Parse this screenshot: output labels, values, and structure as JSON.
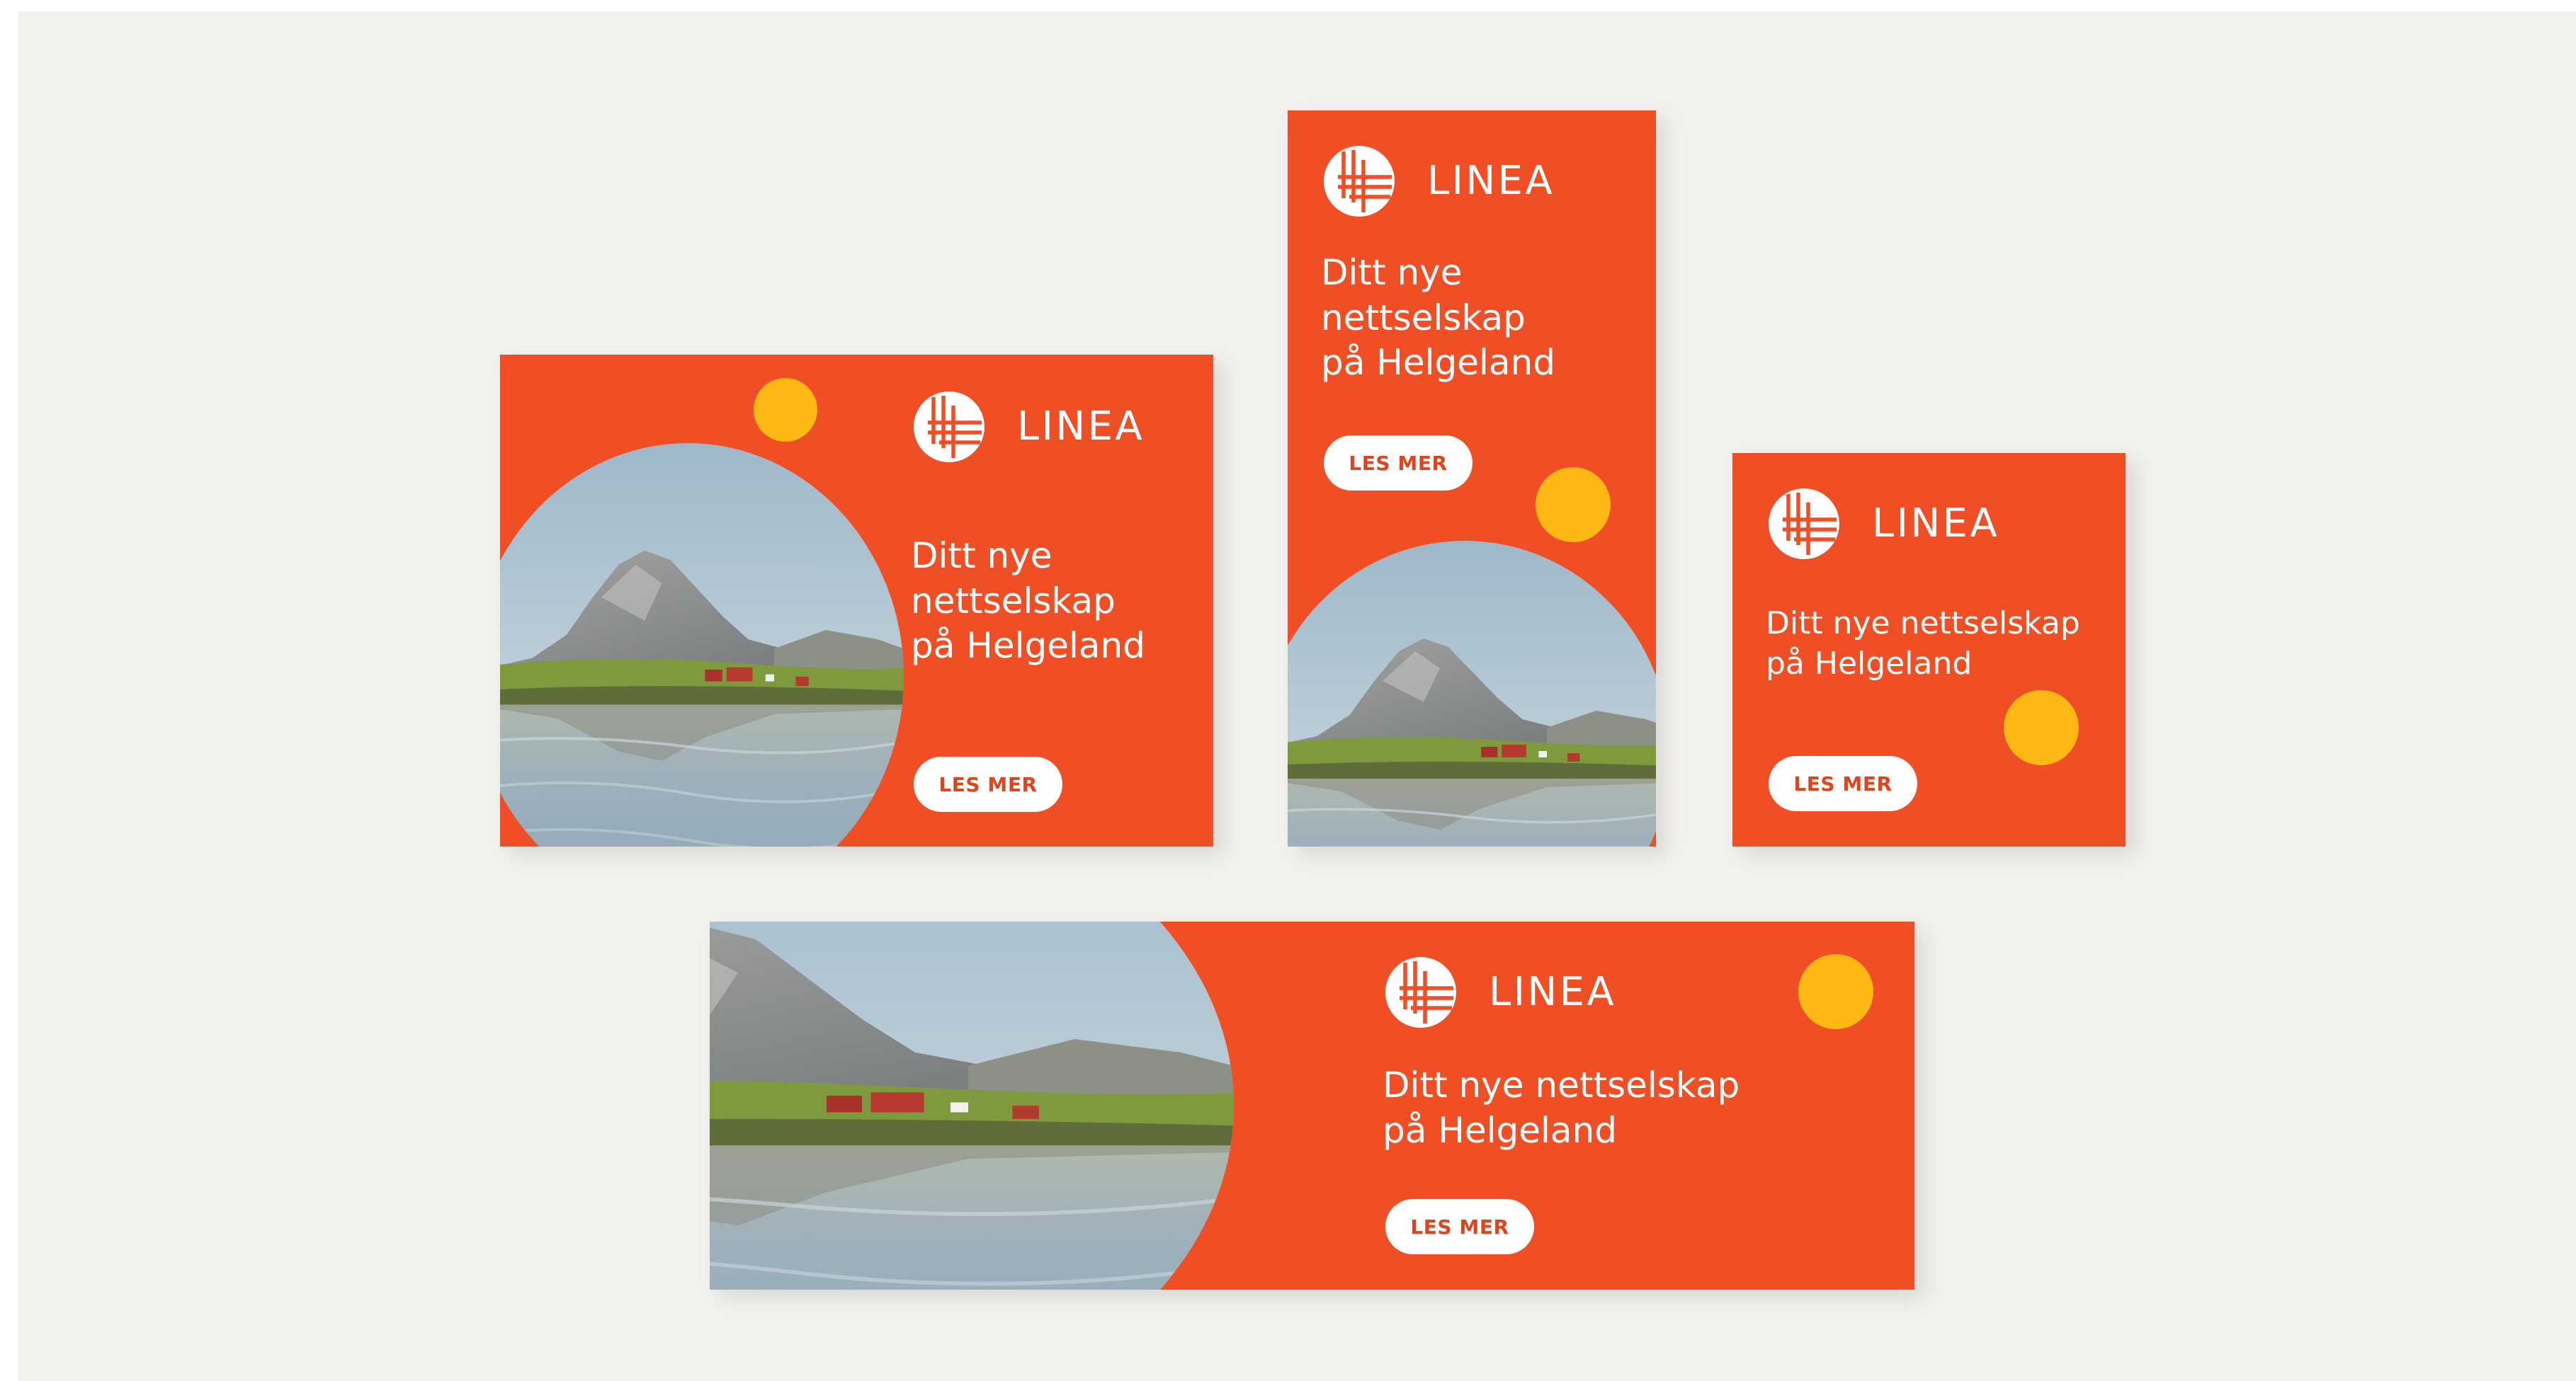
{
  "colors": {
    "background": "#f3f1ed",
    "brand_orange": "#f04f26",
    "accent_yellow": "#fdb813",
    "button_text": "#e0441c",
    "text": "#ffffff"
  },
  "icons": [
    "linea-logo-icon",
    "photo-coastal-landscape"
  ],
  "banners": {
    "medium_rectangle": {
      "logo_text": "LINEA",
      "headline": "Ditt nye\nnettselskap\npå Helgeland",
      "cta_label": "LES MER"
    },
    "skyscraper": {
      "logo_text": "LINEA",
      "headline": "Ditt nye\nnettselskap\npå Helgeland",
      "cta_label": "LES MER"
    },
    "square": {
      "logo_text": "LINEA",
      "headline": "Ditt nye nettselskap\npå Helgeland",
      "cta_label": "LES MER"
    },
    "leaderboard": {
      "logo_text": "LINEA",
      "headline": "Ditt nye nettselskap\npå Helgeland",
      "cta_label": "LES MER"
    }
  }
}
